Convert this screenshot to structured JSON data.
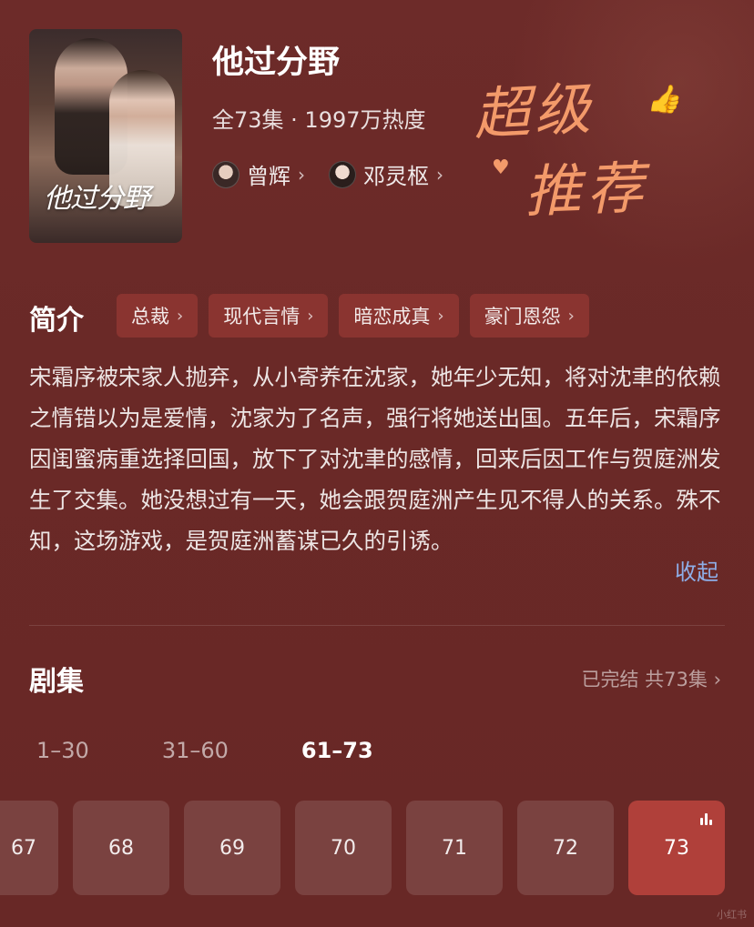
{
  "header": {
    "title": "他过分野",
    "meta": "全73集 · 1997万热度",
    "cast": [
      {
        "name": "曾辉"
      },
      {
        "name": "邓灵枢"
      }
    ],
    "poster_title": "他过分野",
    "handwriting": {
      "line1": "超级",
      "line2": "推荐"
    }
  },
  "intro": {
    "heading": "简介",
    "tags": [
      "总裁",
      "现代言情",
      "暗恋成真",
      "豪门恩怨"
    ],
    "description": "宋霜序被宋家人抛弃，从小寄养在沈家，她年少无知，将对沈聿的依赖之情错以为是爱情，沈家为了名声，强行将她送出国。五年后，宋霜序因闺蜜病重选择回国，放下了对沈聿的感情，回来后因工作与贺庭洲发生了交集。她没想过有一天，她会跟贺庭洲产生见不得人的关系。殊不知，这场游戏，是贺庭洲蓄谋已久的引诱。",
    "collapse_label": "收起"
  },
  "episodes": {
    "heading": "剧集",
    "status": "已完结 共73集",
    "ranges": [
      "1–30",
      "31–60",
      "61–73"
    ],
    "active_range": "61–73",
    "items": [
      "67",
      "68",
      "69",
      "70",
      "71",
      "72",
      "73"
    ],
    "current": "73"
  },
  "colors": {
    "background": "#6b2a28",
    "accent": "#b0403a",
    "link": "#8eaee8",
    "handwriting": "#f39a6a"
  },
  "watermark": "小红书"
}
